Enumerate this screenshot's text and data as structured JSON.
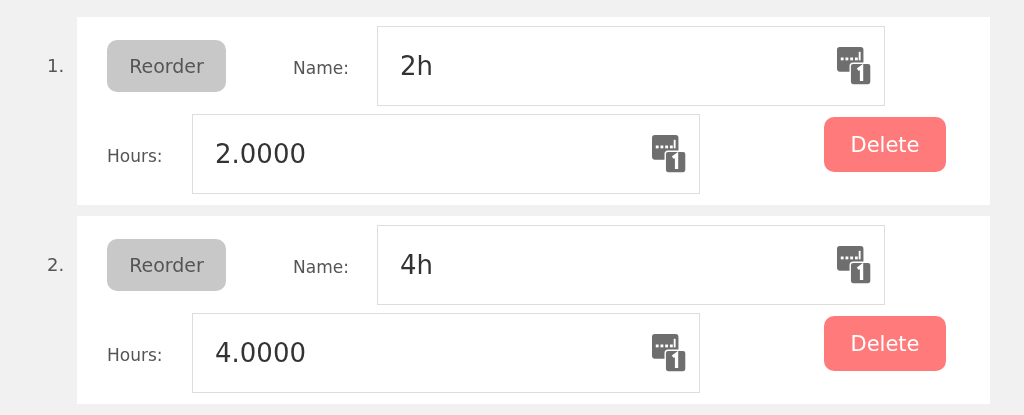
{
  "entries": [
    {
      "number": "1.",
      "reorder_label": "Reorder",
      "name_label": "Name:",
      "name_value": "2h",
      "hours_label": "Hours:",
      "hours_value": "2.0000",
      "delete_label": "Delete"
    },
    {
      "number": "2.",
      "reorder_label": "Reorder",
      "name_label": "Name:",
      "name_value": "4h",
      "hours_label": "Hours:",
      "hours_value": "4.0000",
      "delete_label": "Delete"
    }
  ]
}
